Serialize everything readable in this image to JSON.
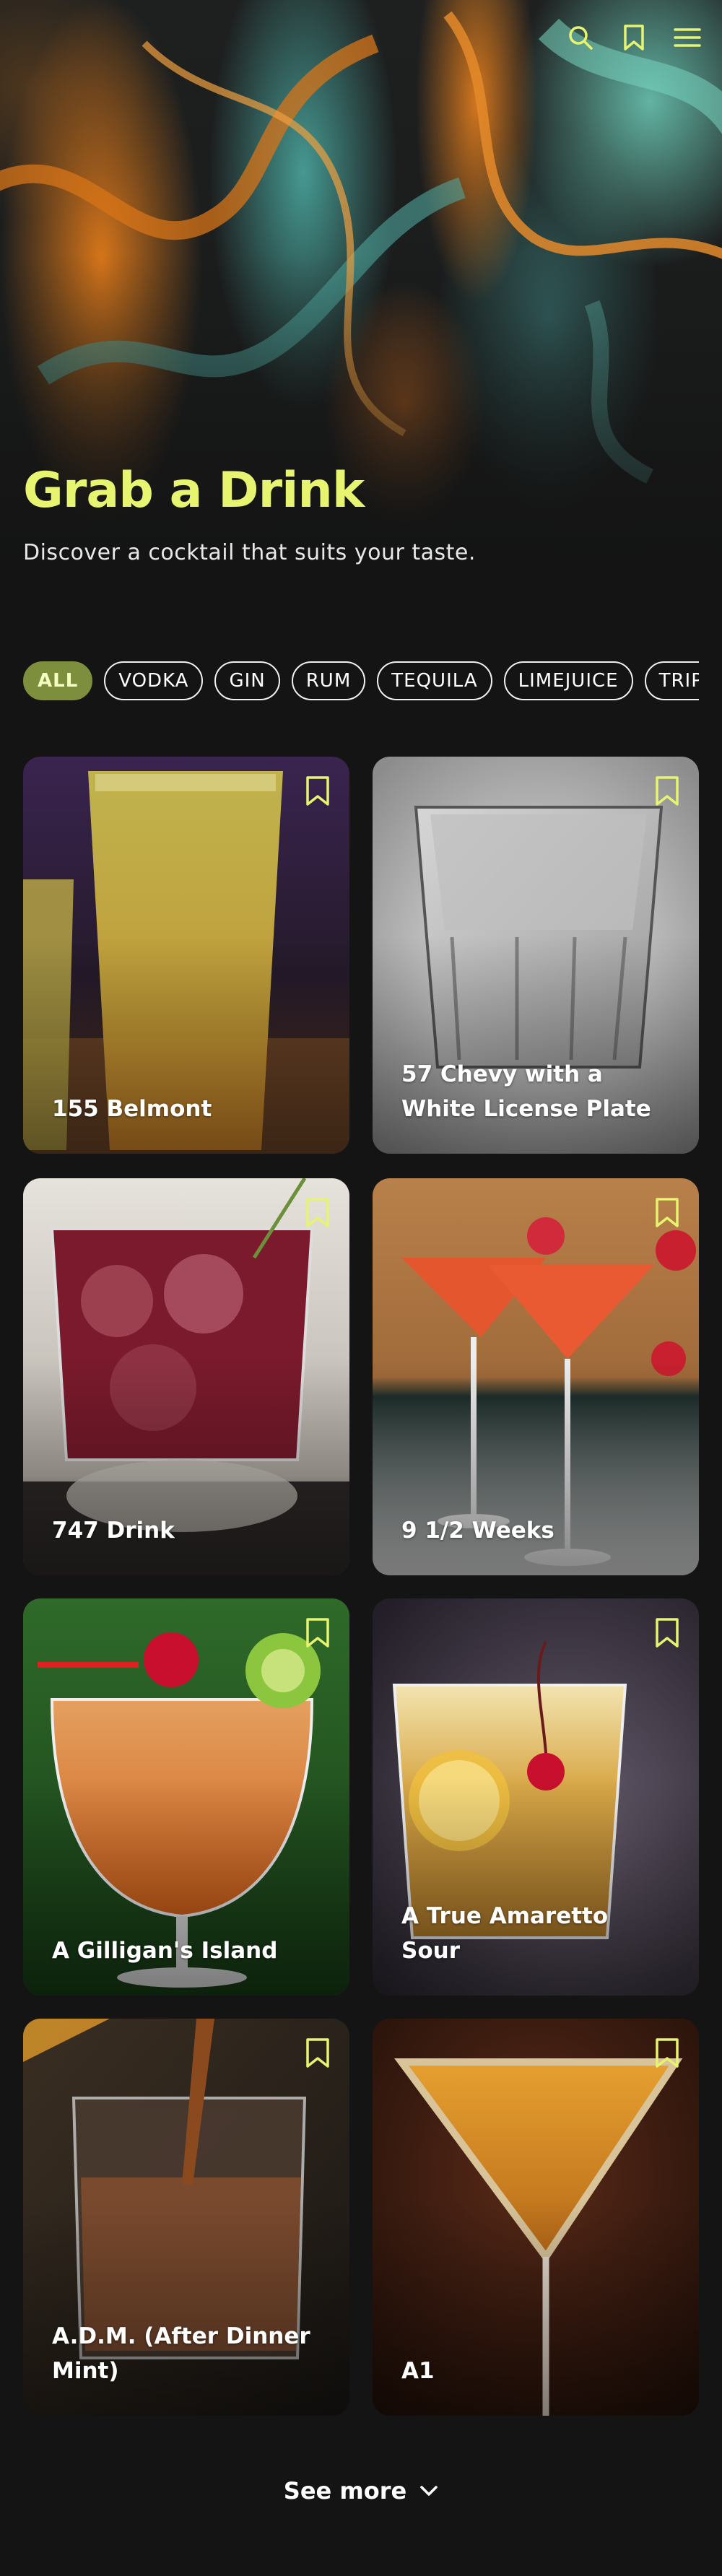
{
  "hero": {
    "title": "Grab a Drink",
    "subtitle": "Discover a cocktail that suits your taste."
  },
  "header_icons": [
    "search-icon",
    "bookmark-icon",
    "menu-icon"
  ],
  "filters": [
    "ALL",
    "VODKA",
    "GIN",
    "RUM",
    "TEQUILA",
    "LIMEJUICE",
    "TRIPLE SEC"
  ],
  "active_filter": "ALL",
  "drinks": [
    {
      "name": "155 Belmont"
    },
    {
      "name": "57 Chevy with a White License Plate"
    },
    {
      "name": "747 Drink"
    },
    {
      "name": "9 1/2 Weeks"
    },
    {
      "name": "A Gilligan's Island"
    },
    {
      "name": "A True Amaretto Sour"
    },
    {
      "name": "A.D.M. (After Dinner Mint)"
    },
    {
      "name": "A1"
    }
  ],
  "see_more": {
    "label": "See more",
    "icon": "chevron-down-icon"
  },
  "colors": {
    "accent": "#e6f470",
    "active_chip": "#7d8f3c",
    "background": "#141414"
  }
}
